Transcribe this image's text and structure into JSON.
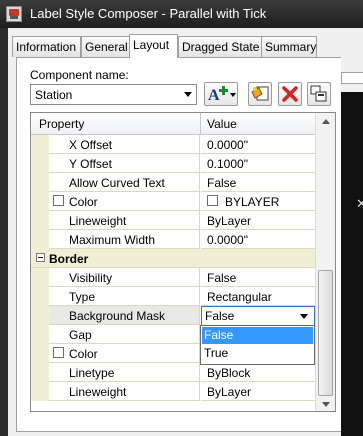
{
  "window": {
    "title": "Label Style Composer - Parallel with Tick"
  },
  "tabs": [
    {
      "label": "Information"
    },
    {
      "label": "General"
    },
    {
      "label": "Layout"
    },
    {
      "label": "Dragged State"
    },
    {
      "label": "Summary"
    }
  ],
  "active_tab": "Layout",
  "component": {
    "label": "Component name:",
    "value": "Station"
  },
  "toolbar": {
    "icons": [
      "add-component-icon",
      "copy-component-icon",
      "delete-component-icon",
      "component-draw-order-icon"
    ]
  },
  "grid": {
    "headers": {
      "property": "Property",
      "value": "Value"
    },
    "rows": [
      {
        "name": "X Offset",
        "value": "0.0000\""
      },
      {
        "name": "Y Offset",
        "value": "0.1000\""
      },
      {
        "name": "Allow Curved Text",
        "value": "False"
      },
      {
        "name": "Color",
        "value": "BYLAYER"
      },
      {
        "name": "Lineweight",
        "value": "ByLayer"
      },
      {
        "name": "Maximum Width",
        "value": "0.0000\""
      }
    ],
    "category": {
      "name": "Border"
    },
    "border_rows": [
      {
        "name": "Visibility",
        "value": "False"
      },
      {
        "name": "Type",
        "value": "Rectangular"
      },
      {
        "name": "Background Mask",
        "value": "False"
      },
      {
        "name": "Gap",
        "value": ""
      },
      {
        "name": "Color",
        "value": ""
      },
      {
        "name": "Linetype",
        "value": "ByBlock"
      },
      {
        "name": "Lineweight",
        "value": "ByLayer"
      }
    ]
  },
  "dropdown": {
    "options": [
      "False",
      "True"
    ],
    "selected": "False"
  },
  "colors": {
    "grid_gutter": "#f1eed6",
    "selection": "#3399ff",
    "delete_red": "#d42222"
  }
}
